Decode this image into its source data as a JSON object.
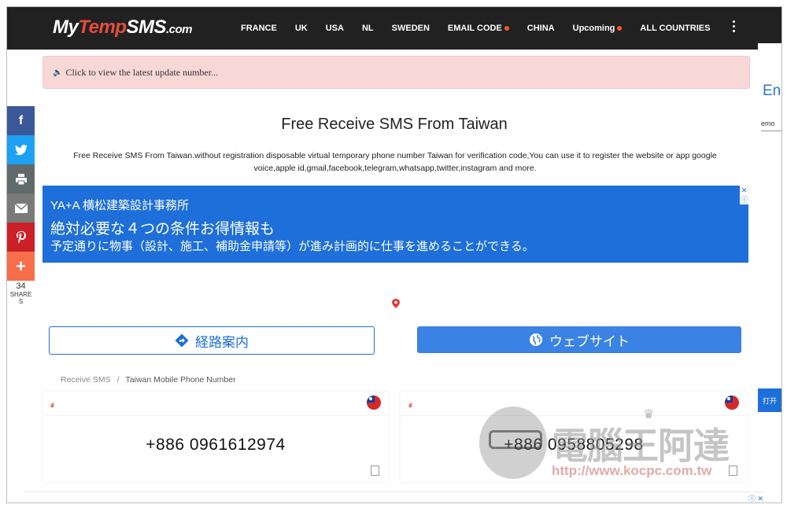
{
  "nav": {
    "logo": {
      "part1": "My",
      "part2": "Temp",
      "part3": "SMS",
      "part4": ".com"
    },
    "items": [
      {
        "label": "FRANCE",
        "dot": false
      },
      {
        "label": "UK",
        "dot": false
      },
      {
        "label": "USA",
        "dot": false
      },
      {
        "label": "NL",
        "dot": false
      },
      {
        "label": "SWEDEN",
        "dot": false
      },
      {
        "label": "EMAIL CODE",
        "dot": true
      },
      {
        "label": "CHINA",
        "dot": false
      },
      {
        "label": "Upcoming",
        "dot": true
      },
      {
        "label": "ALL COUNTRIES",
        "dot": false
      }
    ]
  },
  "notice": {
    "text": "Click to view the latest update number..."
  },
  "page": {
    "title": "Free Receive SMS From Taiwan",
    "description": "Free Receive SMS From Taiwan.without registration disposable virtual temporary phone number Taiwan for verification code,You can use it to register the website or app google voice,apple id,gmail,facebook,telegram,whatsapp,twitter,instagram and more."
  },
  "ad": {
    "line1": "YA+A 横松建築設計事務所",
    "line2": "絶対必要な４つの条件お得情報も",
    "line3": "予定通りに物事（設計、施工、補助金申請等）が進み計画的に仕事を進めることができる。",
    "route_button": "経路案内",
    "website_button": "ウェブサイト"
  },
  "breadcrumb": {
    "home": "Receive SMS",
    "separator": "/",
    "current": "Taiwan Mobile Phone Number"
  },
  "cards": [
    {
      "number": "+886 0961612974",
      "signal": "ııl",
      "flag": "taiwan-flag"
    },
    {
      "number": "+886 0958805298",
      "signal": "ııl",
      "flag": "taiwan-flag"
    }
  ],
  "share": {
    "count": "34",
    "label_line1": "SHARE",
    "label_line2": "S"
  },
  "right_strip": {
    "en": "En",
    "emo": "emo",
    "open": "打开"
  },
  "watermark": {
    "title": "電腦王阿達",
    "url": "http://www.kocpc.com.tw"
  },
  "colors": {
    "nav_bg": "#212121",
    "accent": "#1e6fd9",
    "notice_bg": "#f8d7d7",
    "logo_red": "#e74c3c"
  }
}
